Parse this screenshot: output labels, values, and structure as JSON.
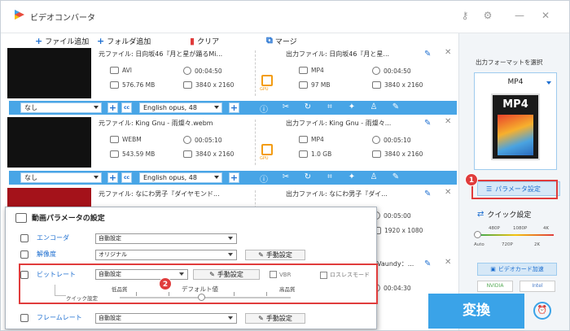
{
  "app": {
    "title": "ビデオコンバータ"
  },
  "toolbar": {
    "add_file": "ファイル追加",
    "add_folder": "フォルダ追加",
    "clear": "クリア",
    "merge": "マージ"
  },
  "files": [
    {
      "src": "元ファイル: 日向坂46『月と星が踊るMi...",
      "out": "出力ファイル: 日向坂46『月と星...",
      "src_fmt": "AVI",
      "src_dur": "00:04:50",
      "src_size": "576.76 MB",
      "src_res": "3840 x 2160",
      "out_fmt": "MP4",
      "out_dur": "00:04:50",
      "out_size": "97 MB",
      "out_res": "3840 x 2160"
    },
    {
      "src": "元ファイル: King Gnu - 雨燦々.webm",
      "out": "出力ファイル: King Gnu - 雨燦々...",
      "src_fmt": "WEBM",
      "src_dur": "00:05:10",
      "src_size": "543.59 MB",
      "src_res": "3840 x 2160",
      "out_fmt": "MP4",
      "out_dur": "00:05:10",
      "out_size": "1.0 GB",
      "out_res": "3840 x 2160"
    },
    {
      "src": "元ファイル: なにわ男子『ダイヤモンド...",
      "out": "出力ファイル: なにわ男子『ダイ...",
      "out_dur": "00:05:00",
      "out_res": "1920 x 1080"
    },
    {
      "out": "Vaundy：...",
      "out_dur": "00:04:30"
    }
  ],
  "editbar": {
    "subtitle": "なし",
    "audio": "English opus, 48"
  },
  "gpu_label": "GPU",
  "side": {
    "output_label": "出力フォーマットを選択",
    "format": "MP4",
    "format_icon_text": "MP4",
    "param_button": "パラメータ設定",
    "quick_label": "クイック設定",
    "ticks_top": [
      "480P",
      "1080P",
      "4K"
    ],
    "ticks_bottom": [
      "Auto",
      "720P",
      "2K"
    ],
    "hw_button": "ビデオカード加速",
    "vendors": [
      "NVIDIA",
      "Intel"
    ],
    "convert": "変換"
  },
  "badges": {
    "one": "1",
    "two": "2"
  },
  "dialog": {
    "title": "動画パラメータの設定",
    "encoder_label": "エンコーダ",
    "encoder_value": "自動設定",
    "resolution_label": "解像度",
    "resolution_value": "オリジナル",
    "manual": "手動設定",
    "bitrate_label": "ビットレート",
    "bitrate_value": "自動設定",
    "vbr": "VBR",
    "lossless": "ロスレスモード",
    "quick_label": "クイック設定",
    "low": "低品質",
    "default": "デフォルト値",
    "high": "高品質",
    "framerate_label": "フレームレート",
    "framerate_value": "自動設定"
  }
}
